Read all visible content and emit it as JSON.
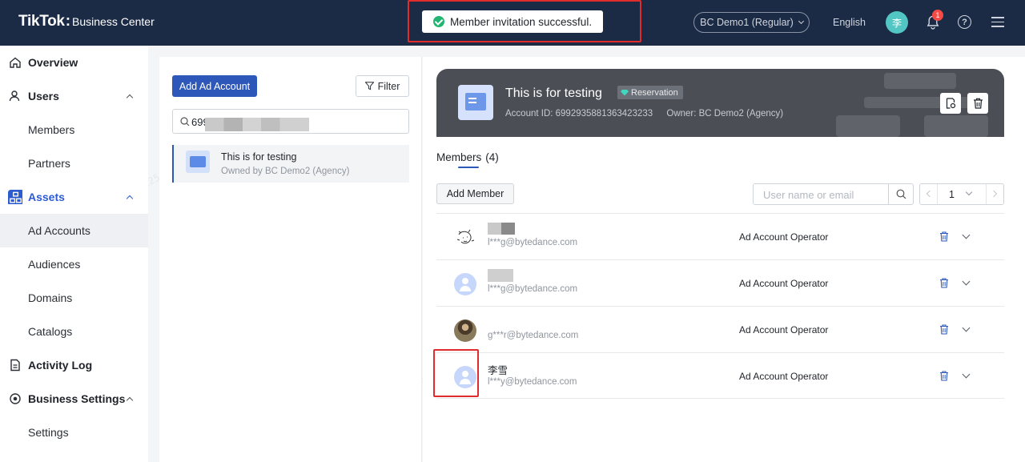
{
  "header": {
    "brand": "TikTok",
    "product": "Business Center",
    "toast": "Member invitation successful.",
    "bc_switch": "BC Demo1 (Regular)",
    "language": "English",
    "avatar_initial": "李",
    "notification_count": "1",
    "icons": [
      "check-circle-icon",
      "chevron-down-icon",
      "bell-icon",
      "help-icon",
      "menu-icon"
    ]
  },
  "sidebar": {
    "items": [
      {
        "label": "Overview",
        "icon": "home-icon",
        "type": "top"
      },
      {
        "label": "Users",
        "icon": "user-icon",
        "type": "group"
      },
      {
        "label": "Members",
        "type": "sub"
      },
      {
        "label": "Partners",
        "type": "sub"
      },
      {
        "label": "Assets",
        "icon": "assets-icon",
        "type": "group-active"
      },
      {
        "label": "Ad Accounts",
        "type": "sub-selected"
      },
      {
        "label": "Audiences",
        "type": "sub"
      },
      {
        "label": "Domains",
        "type": "sub"
      },
      {
        "label": "Catalogs",
        "type": "sub"
      },
      {
        "label": "Activity Log",
        "icon": "document-icon",
        "type": "top"
      },
      {
        "label": "Business Settings",
        "icon": "settings-icon",
        "type": "group"
      },
      {
        "label": "Settings",
        "type": "sub"
      }
    ]
  },
  "accounts_panel": {
    "add_button": "Add Ad Account",
    "filter_button": "Filter",
    "search_value": "699",
    "accounts": [
      {
        "name": "This is for testing",
        "owner": "Owned by BC Demo2 (Agency)"
      }
    ]
  },
  "detail": {
    "title": "This is for testing",
    "tag": "Reservation",
    "account_id": "Account ID: 6992935881363423233",
    "owner": "Owner: BC Demo2 (Agency)",
    "tab_label": "Members",
    "tab_count": "(4)",
    "add_member": "Add Member",
    "search_placeholder": "User name or email",
    "page": "1",
    "members": [
      {
        "name": "",
        "email": "l***g@bytedance.com",
        "role": "Ad Account Operator",
        "avatar": "sketch"
      },
      {
        "name": "",
        "email": "l***g@bytedance.com",
        "role": "Ad Account Operator",
        "avatar": "default"
      },
      {
        "name": "",
        "email": "g***r@bytedance.com",
        "role": "Ad Account Operator",
        "avatar": "photo"
      },
      {
        "name": "李雪",
        "email": "l***y@bytedance.com",
        "role": "Ad Account Operator",
        "avatar": "default"
      }
    ]
  },
  "colors": {
    "header_bg": "#1c2b45",
    "primary": "#2d57b8",
    "success": "#21b571",
    "highlight": "#e02c2c"
  }
}
